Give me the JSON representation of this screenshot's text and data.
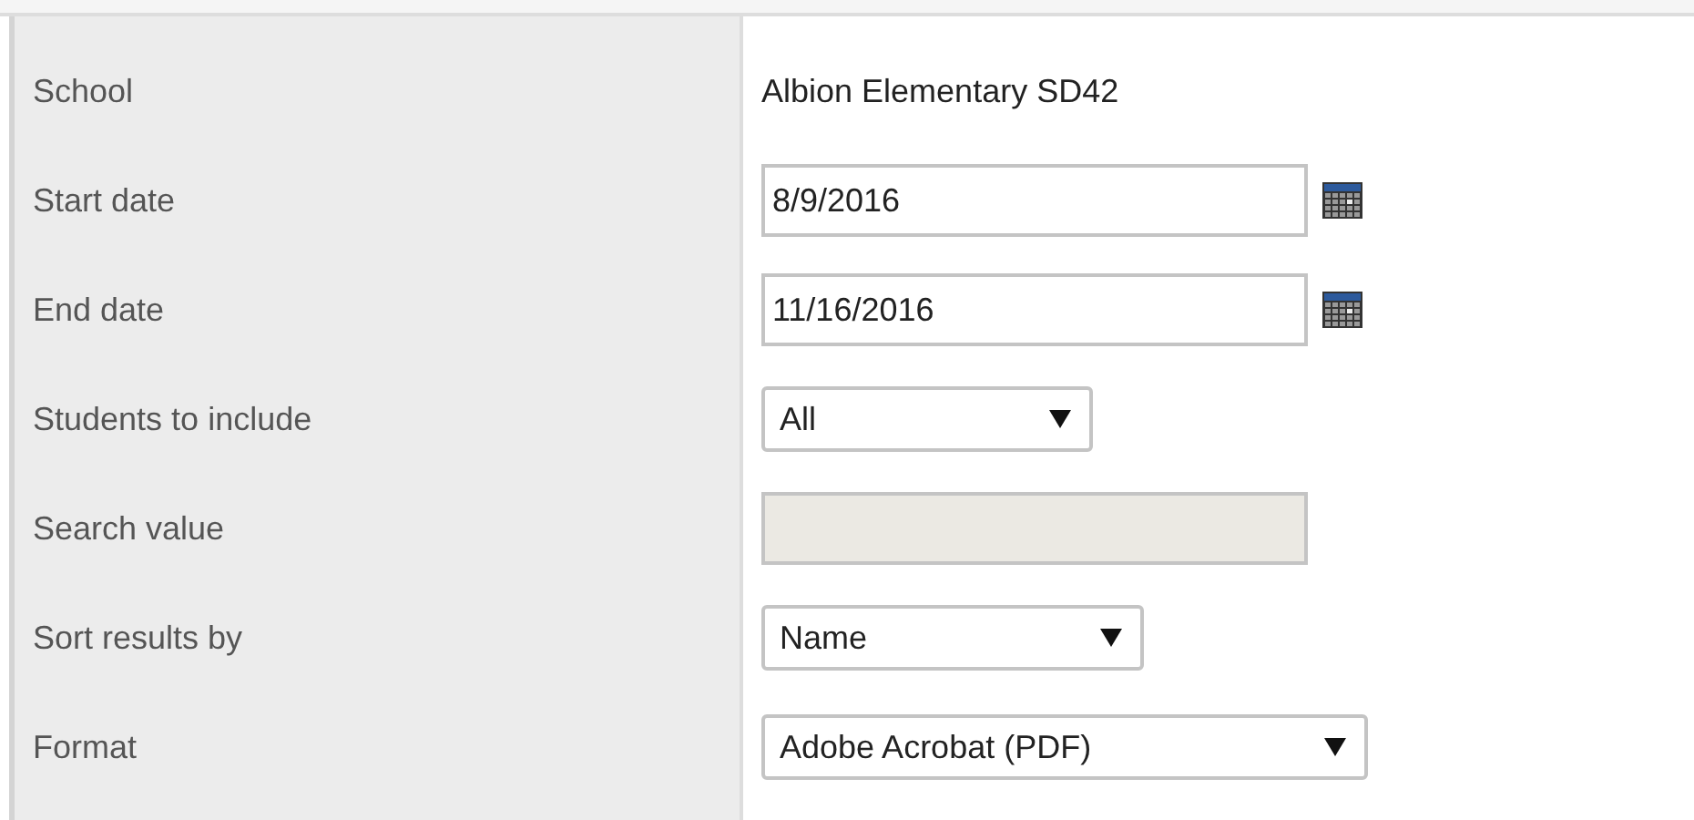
{
  "fields": [
    {
      "label": "School",
      "kind": "text",
      "value": "Albion Elementary SD42"
    },
    {
      "label": "Start date",
      "kind": "date",
      "value": "8/9/2016"
    },
    {
      "label": "End date",
      "kind": "date",
      "value": "11/16/2016"
    },
    {
      "label": "Students to include",
      "kind": "select",
      "value": "All"
    },
    {
      "label": "Search value",
      "kind": "input",
      "disabled": true
    },
    {
      "label": "Sort results by",
      "kind": "select",
      "value": "Name"
    },
    {
      "label": "Format",
      "kind": "select",
      "value": "Adobe Acrobat (PDF)"
    }
  ]
}
